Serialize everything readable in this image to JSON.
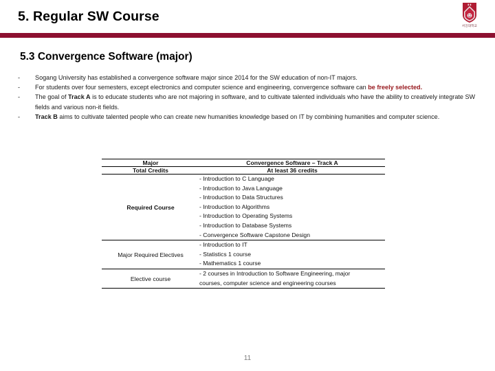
{
  "header": {
    "title": "5. Regular SW Course",
    "logo_name": "sogang-university-emblem",
    "logo_caption": "서강대학교",
    "accent_color": "#8d1030"
  },
  "section": {
    "heading": "5.3 Convergence Software (major)"
  },
  "bullets": [
    {
      "marker": "-",
      "parts": [
        {
          "text": "Sogang University has established a convergence software major since 2014 for the SW education of non-IT majors.",
          "style": "normal"
        }
      ]
    },
    {
      "marker": "-",
      "parts": [
        {
          "text": "For students over four semesters, except electronics and computer science and  engineering, convergence software can ",
          "style": "normal"
        },
        {
          "text": "be freely selected.",
          "style": "highlight"
        }
      ]
    },
    {
      "marker": "-",
      "parts": [
        {
          "text": "The goal of ",
          "style": "normal"
        },
        {
          "text": "Track A",
          "style": "bold"
        },
        {
          "text": " is to educate students who are not majoring in software, and to cultivate talented individuals who have the ability to creatively integrate SW fields and various non-it fields.",
          "style": "normal"
        }
      ]
    },
    {
      "marker": "-",
      "parts": [
        {
          "text": "Track B",
          "style": "bold"
        },
        {
          "text": " aims to cultivate talented people who can create new humanities knowledge based on IT by combining humanities and computer science.",
          "style": "normal"
        }
      ]
    }
  ],
  "table": {
    "header": {
      "label": "Major",
      "value": "Convergence Software – Track A"
    },
    "rows": [
      {
        "label": "Total Credits",
        "label_bold": true,
        "value_type": "centered",
        "value": "At least 36 credits"
      },
      {
        "label": "Required Course",
        "label_bold": true,
        "value_type": "list",
        "items": [
          "- Introduction to C Language",
          "- Introduction to Java Language",
          "- Introduction to Data Structures",
          "- Introduction to Algorithms",
          "- Introduction to Operating Systems",
          "- Introduction to Database Systems",
          "- Convergence Software Capstone Design"
        ]
      },
      {
        "label": "Major Required Electives",
        "label_bold": false,
        "value_type": "list",
        "items": [
          "- Introduction to IT",
          "- Statistics 1 course",
          "- Mathematics 1 course"
        ]
      },
      {
        "label": "Elective course",
        "label_bold": false,
        "value_type": "paragraph",
        "value": "- 2 courses in Introduction to Software Engineering, major courses, computer science and engineering courses"
      }
    ]
  },
  "footer": {
    "page_number": "11"
  }
}
